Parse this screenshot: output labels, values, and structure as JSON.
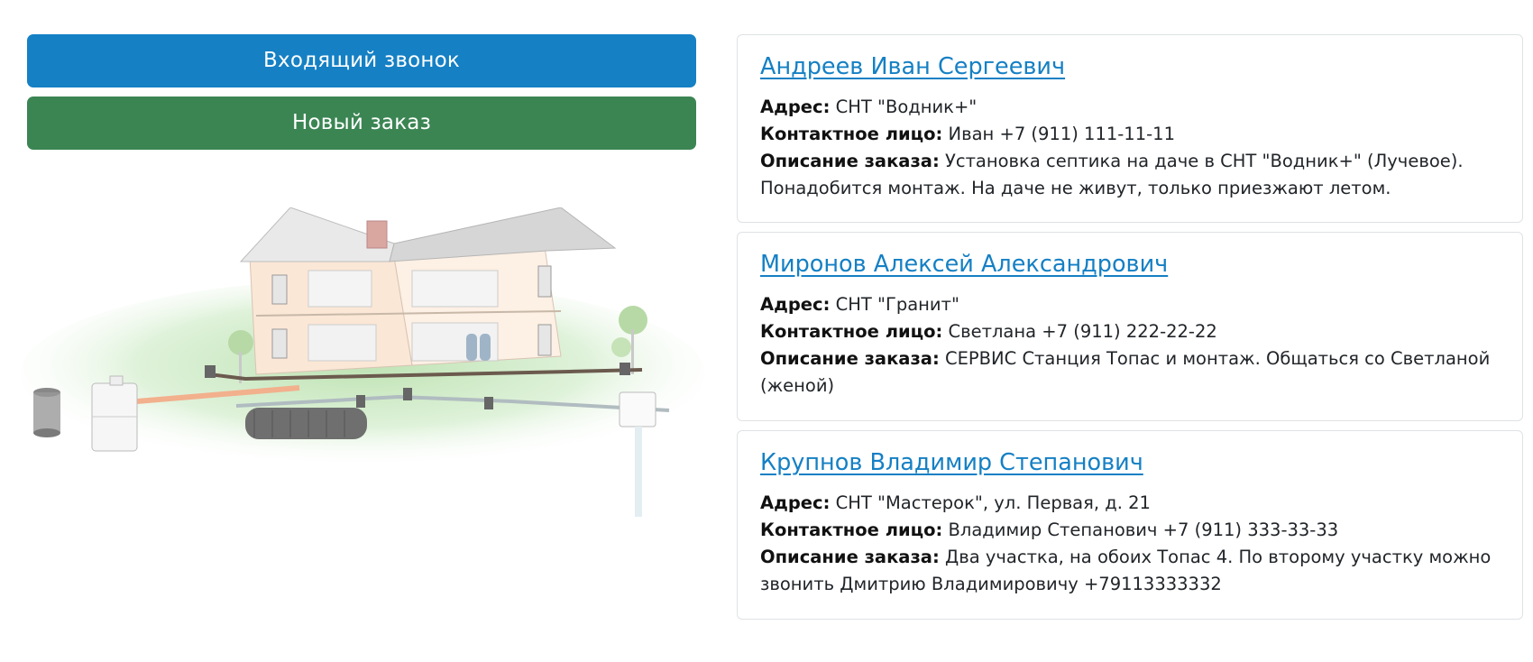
{
  "buttons": {
    "incoming_call": "Входящий звонок",
    "new_order": "Новый заказ"
  },
  "labels": {
    "address": "Адрес:",
    "contact": "Контактное лицо:",
    "description": "Описание заказа:"
  },
  "orders": [
    {
      "name": "Андреев Иван Сергеевич",
      "address": "СНТ \"Водник+\"",
      "contact": "Иван +7 (911) 111-11-11",
      "description": "Установка септика на даче в СНТ \"Водник+\" (Лучевое). Понадобится монтаж. На даче не живут, только приезжают летом."
    },
    {
      "name": "Миронов Алексей Александрович",
      "address": "СНТ \"Гранит\"",
      "contact": "Светлана +7 (911) 222-22-22",
      "description": "СЕРВИС Станция Топас и монтаж. Общаться со Светланой (женой)"
    },
    {
      "name": "Крупнов Владимир Степанович",
      "address": "СНТ \"Мастерок\", ул. Первая, д. 21",
      "contact": "Владимир Степанович +7 (911) 333-33-33",
      "description": "Два участка, на обоих Топас 4. По второму участку можно звонить Дмитрию Владимировичу +79113333332"
    }
  ],
  "colors": {
    "primary": "#1580c4",
    "success": "#3b8553",
    "card_border": "#dfe2e5"
  },
  "illustration": "house-septic-system-illustration"
}
